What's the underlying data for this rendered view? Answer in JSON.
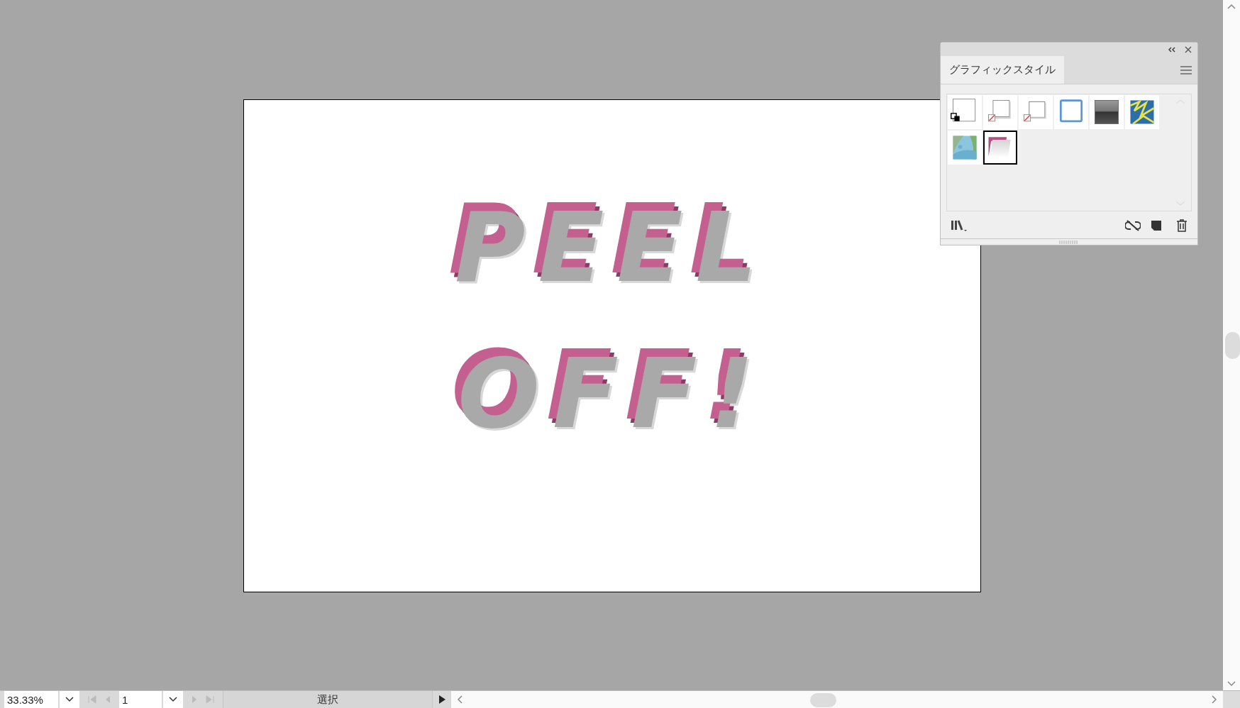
{
  "artwork": {
    "lines": [
      "PEEL",
      "OFF!"
    ]
  },
  "panel": {
    "tabs": [
      {
        "label": "グラフィックスタイル",
        "selected": true
      }
    ],
    "swatches": [
      {
        "kind": "default",
        "selected": false
      },
      {
        "kind": "shadow",
        "selected": false
      },
      {
        "kind": "shadow2",
        "selected": false
      },
      {
        "kind": "blueframe",
        "selected": false
      },
      {
        "kind": "gradient",
        "selected": false
      },
      {
        "kind": "bluepattern",
        "selected": false
      },
      {
        "kind": "greenpattern",
        "selected": false
      },
      {
        "kind": "peel",
        "selected": true
      }
    ]
  },
  "status_bar": {
    "zoom": "33.33%",
    "page": "1",
    "tool": "選択"
  }
}
